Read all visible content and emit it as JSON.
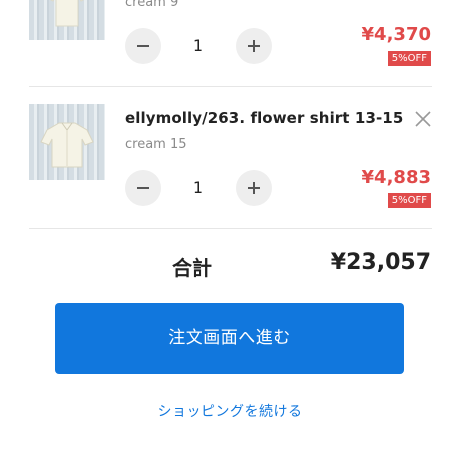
{
  "cart": {
    "items": [
      {
        "title": "",
        "variant": "cream 9",
        "quantity": "1",
        "price": "¥4,370",
        "discount": "5%OFF"
      },
      {
        "title": "ellymolly/263. flower shirt 13-15",
        "variant": "cream 15",
        "quantity": "1",
        "price": "¥4,883",
        "discount": "5%OFF"
      }
    ]
  },
  "summary": {
    "total_label": "合計",
    "total_value": "¥23,057"
  },
  "actions": {
    "checkout_label": "注文画面へ進む",
    "continue_label": "ショッピングを続ける"
  },
  "icons": {
    "minus": "minus-icon",
    "plus": "plus-icon",
    "close": "close-icon"
  },
  "colors": {
    "price": "#e04a4a",
    "primary": "#1177dd"
  }
}
